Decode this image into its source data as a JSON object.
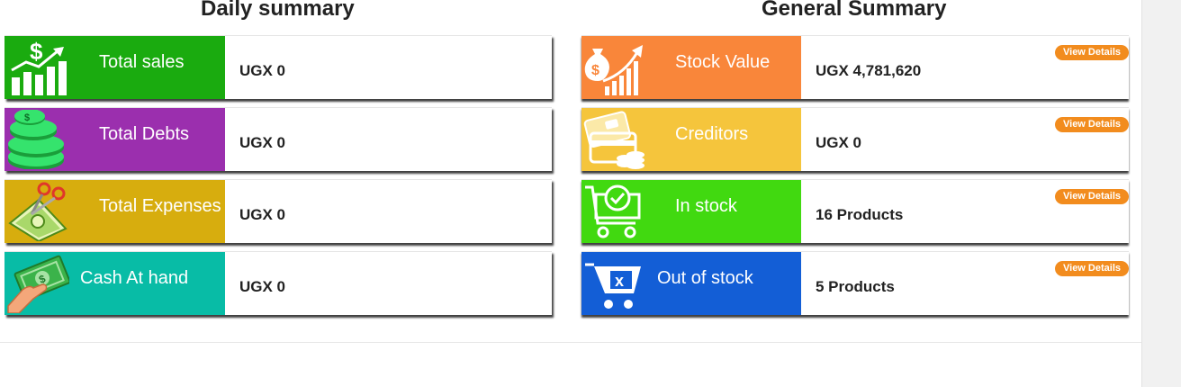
{
  "daily": {
    "title": "Daily summary",
    "cards": [
      {
        "label": "Total sales",
        "value": "UGX 0",
        "color": "#1aab0f",
        "icon": "sales-chart-icon"
      },
      {
        "label": "Total Debts",
        "value": "UGX 0",
        "color": "#9b2fae",
        "icon": "coins-stack-icon"
      },
      {
        "label": "Total Expenses",
        "value": "UGX 0",
        "color": "#d7ad0e",
        "icon": "scissors-cash-icon"
      },
      {
        "label": "Cash At hand",
        "value": "UGX 0",
        "color": "#08bca6",
        "icon": "cash-hand-icon"
      }
    ]
  },
  "general": {
    "title": "General Summary",
    "details_label": "View Details",
    "cards": [
      {
        "label": "Stock Value",
        "value": "UGX 4,781,620",
        "color": "#f9863a",
        "icon": "money-bag-growth-icon"
      },
      {
        "label": "Creditors",
        "value": "UGX 0",
        "color": "#f5c53c",
        "icon": "credit-card-coins-icon"
      },
      {
        "label": "In stock",
        "value": "16 Products",
        "color": "#41d910",
        "icon": "cart-check-icon"
      },
      {
        "label": "Out of stock",
        "value": "5 Products",
        "color": "#135ed6",
        "icon": "cart-x-icon"
      }
    ]
  }
}
